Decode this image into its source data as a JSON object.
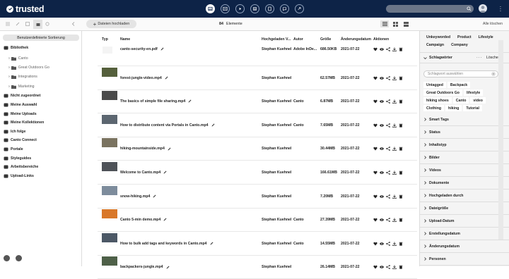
{
  "app": {
    "logo_text": "trusted",
    "brand_color": "#0d2347"
  },
  "topbar": {
    "tabs": [
      "images-tab",
      "library-tab",
      "play-tab",
      "folder-tab",
      "document-tab",
      "chat-tab",
      "link-tab"
    ],
    "search_placeholder": ""
  },
  "toolbar": {
    "upload_label": "Dateien hochladen",
    "count": "84",
    "count_label": "Elemente",
    "clear_all": "Alle löschen"
  },
  "sidebar": {
    "sort_label": "Benutzerdefinierte Sortierung",
    "items": [
      {
        "label": "Bibliothek",
        "level": 0
      },
      {
        "label": "Canto",
        "level": 1
      },
      {
        "label": "Great Outdoors Go",
        "level": 1
      },
      {
        "label": "Integrations",
        "level": 1
      },
      {
        "label": "Marketing",
        "level": 1
      },
      {
        "label": "Nicht zugeordnet",
        "level": 0
      },
      {
        "label": "Meine Auswahl",
        "level": 0
      },
      {
        "label": "Meine Uploads",
        "level": 0
      },
      {
        "label": "Meine Kollektionen",
        "level": 0
      },
      {
        "label": "Ich folge",
        "level": 0
      },
      {
        "label": "Canto Connect",
        "level": 0
      },
      {
        "label": "Portale",
        "level": 0
      },
      {
        "label": "Styleguides",
        "level": 0
      },
      {
        "label": "Arbeitsbereiche",
        "level": 0
      },
      {
        "label": "Upload-Links",
        "level": 0
      }
    ]
  },
  "table": {
    "columns": [
      "Typ",
      "Name",
      "Hochgeladen V...",
      "Autor",
      "Größe",
      "Änderungsdatum",
      "Aktionen"
    ],
    "rows": [
      {
        "name": "canto-security-en.pdf",
        "uploaded_by": "Stephan Kuehnel",
        "author": "Adobe InDe...",
        "size": "686.50KB",
        "date": "2021-07-22"
      },
      {
        "name": "forest-jungle-video.mp4",
        "uploaded_by": "Stephan Kuehnel",
        "author": "",
        "size": "62.57MB",
        "date": "2021-07-22"
      },
      {
        "name": "The basics of simple file sharing.mp4",
        "uploaded_by": "Stephan Kuehnel",
        "author": "Canto",
        "size": "6.87MB",
        "date": "2021-07-22"
      },
      {
        "name": "How to distribute content via Portals in Canto.mp4",
        "uploaded_by": "Stephan Kuehnel",
        "author": "Canto",
        "size": "7.65MB",
        "date": "2021-07-22"
      },
      {
        "name": "hiking-mountainside.mp4",
        "uploaded_by": "Stephan Kuehnel",
        "author": "",
        "size": "30.44MB",
        "date": "2021-07-22"
      },
      {
        "name": "Welcome to Canto.mp4",
        "uploaded_by": "Stephan Kuehnel",
        "author": "",
        "size": "166.61MB",
        "date": "2021-07-22"
      },
      {
        "name": "snow-hiking.mp4",
        "uploaded_by": "Stephan Kuehnel",
        "author": "",
        "size": "7.20MB",
        "date": "2021-07-22"
      },
      {
        "name": "Canto 5-min demo.mp4",
        "uploaded_by": "Stephan Kuehnel",
        "author": "Canto",
        "size": "27.39MB",
        "date": "2021-07-22"
      },
      {
        "name": "How to bulk add tags and keywords in Canto.mp4",
        "uploaded_by": "Stephan Kuehnel",
        "author": "Canto",
        "size": "14.55MB",
        "date": "2021-07-22"
      },
      {
        "name": "backpackers-jungle.mp4",
        "uploaded_by": "Stephan Kuehnel",
        "author": "",
        "size": "26.14MB",
        "date": "2021-07-22"
      }
    ]
  },
  "rpanel": {
    "top_tags": [
      "Unkeyworded",
      "Product",
      "Lifestyle",
      "Campaign",
      "Company"
    ],
    "keywords_title": "Schlagwörter",
    "keywords_clear": "Löschen",
    "keyword_placeholder": "Schlagwort auswählen",
    "keywords": [
      "Untagged",
      "Backpack",
      "Great Outdoors Go",
      "lifestyle",
      "hiking shoes",
      "Canto",
      "video",
      "Clothing",
      "hiking",
      "Tutorial"
    ],
    "sections": [
      "Smart Tags",
      "Status",
      "Inhaltstyp",
      "Bilder",
      "Videos",
      "Dokumente",
      "Hochgeladen durch",
      "Dateigröße",
      "Upload-Datum",
      "Erstellungsdatum",
      "Änderungsdatum",
      "Personen"
    ]
  }
}
